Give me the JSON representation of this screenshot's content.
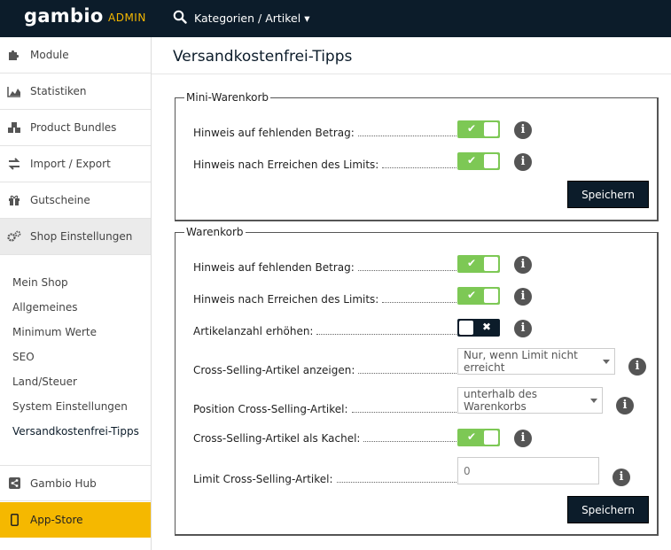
{
  "header": {
    "logo": "gambio",
    "admin_label": "ADMIN",
    "breadcrumb": "Kategorien / Artikel ▾"
  },
  "sidebar": {
    "items": [
      {
        "label": "Module",
        "icon": "puzzle-icon"
      },
      {
        "label": "Statistiken",
        "icon": "chart-icon"
      },
      {
        "label": "Product Bundles",
        "icon": "cubes-icon"
      },
      {
        "label": "Import / Export",
        "icon": "exchange-icon"
      },
      {
        "label": "Gutscheine",
        "icon": "gift-icon"
      },
      {
        "label": "Shop Einstellungen",
        "icon": "gears-icon"
      }
    ],
    "subitems": [
      "Mein Shop",
      "Allgemeines",
      "Minimum Werte",
      "SEO",
      "Land/Steuer",
      "System Einstellungen",
      "Versandkostenfrei-Tipps"
    ],
    "hub": "Gambio Hub",
    "appstore": "App-Store"
  },
  "main": {
    "title": "Versandkostenfrei-Tipps",
    "mini": {
      "legend": "Mini-Warenkorb",
      "rows": [
        {
          "label": "Hinweis auf fehlenden Betrag:",
          "state": "on"
        },
        {
          "label": "Hinweis nach Erreichen des Limits:",
          "state": "on"
        }
      ],
      "save": "Speichern"
    },
    "cart": {
      "legend": "Warenkorb",
      "rows": [
        {
          "label": "Hinweis auf fehlenden Betrag:",
          "state": "on"
        },
        {
          "label": "Hinweis nach Erreichen des Limits:",
          "state": "on"
        },
        {
          "label": "Artikelanzahl erhöhen:",
          "state": "off"
        },
        {
          "label": "Cross-Selling-Artikel anzeigen:",
          "value": "Nur, wenn Limit nicht erreicht"
        },
        {
          "label": "Position Cross-Selling-Artikel:",
          "value": "unterhalb des Warenkorbs"
        },
        {
          "label": "Cross-Selling-Artikel als Kachel:",
          "state": "on"
        },
        {
          "label": "Limit Cross-Selling-Artikel:",
          "value": "0"
        }
      ],
      "save": "Speichern"
    }
  },
  "colors": {
    "topbar": "#0c1c2a",
    "accent": "#f5b800",
    "toggle_on": "#7dc855"
  }
}
